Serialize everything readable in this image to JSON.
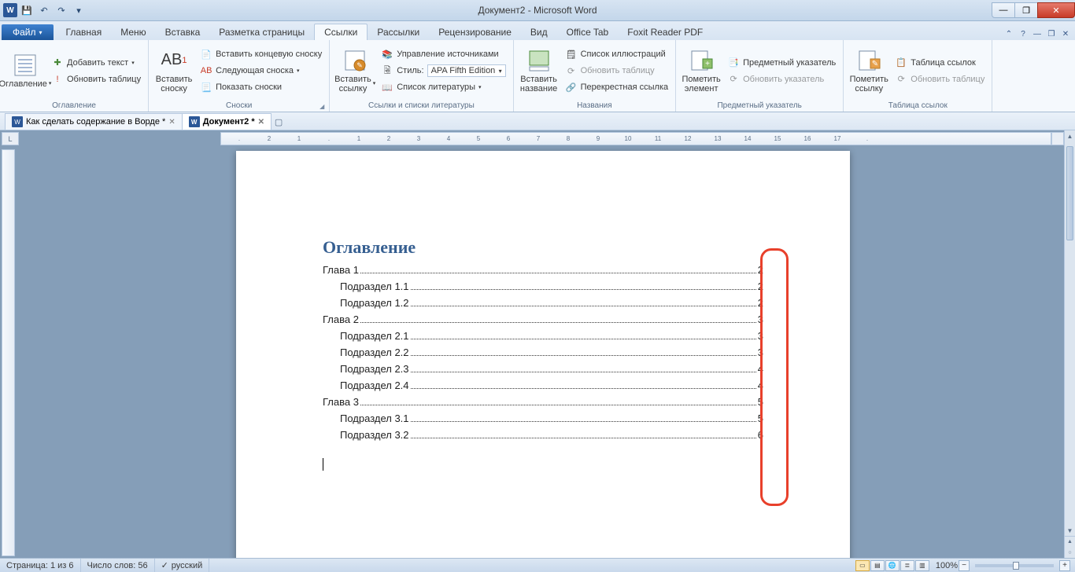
{
  "title": "Документ2 - Microsoft Word",
  "qat": {
    "save": "💾",
    "undo": "↶",
    "redo": "↷"
  },
  "tabs": {
    "file": "Файл",
    "items": [
      "Главная",
      "Меню",
      "Вставка",
      "Разметка страницы",
      "Ссылки",
      "Рассылки",
      "Рецензирование",
      "Вид",
      "Office Tab",
      "Foxit Reader PDF"
    ],
    "active": "Ссылки"
  },
  "ribbon": {
    "g1": {
      "label": "Оглавление",
      "toc": "Оглавление",
      "addText": "Добавить текст",
      "update": "Обновить таблицу"
    },
    "g2": {
      "label": "Сноски",
      "insert": "Вставить\nсноску",
      "endnote": "Вставить концевую сноску",
      "next": "Следующая сноска",
      "show": "Показать сноски",
      "ab": "AB",
      "abSup": "1"
    },
    "g3": {
      "label": "Ссылки и списки литературы",
      "insertCite": "Вставить\nссылку",
      "manage": "Управление источниками",
      "styleLbl": "Стиль:",
      "styleVal": "APA Fifth Edition",
      "biblio": "Список литературы"
    },
    "g4": {
      "label": "Названия",
      "caption": "Вставить\nназвание",
      "figures": "Список иллюстраций",
      "updateTbl": "Обновить таблицу",
      "crossref": "Перекрестная ссылка"
    },
    "g5": {
      "label": "Предметный указатель",
      "mark": "Пометить\nэлемент",
      "index": "Предметный указатель",
      "updateIdx": "Обновить указатель"
    },
    "g6": {
      "label": "Таблица ссылок",
      "markCite": "Пометить\nссылку",
      "toa": "Таблица ссылок",
      "updateToa": "Обновить таблицу"
    }
  },
  "docTabs": [
    {
      "name": "Как сделать содержание в Ворде *",
      "active": false
    },
    {
      "name": "Документ2 *",
      "active": true
    }
  ],
  "ruler": [
    ".",
    "2",
    "1",
    ".",
    "1",
    "2",
    "3",
    "4",
    "5",
    "6",
    "7",
    "8",
    "9",
    "10",
    "11",
    "12",
    "13",
    "14",
    "15",
    "16",
    "17",
    "."
  ],
  "rulerCorner": "L",
  "toc": {
    "title": "Оглавление",
    "entries": [
      {
        "level": 1,
        "text": "Глава 1",
        "page": "2"
      },
      {
        "level": 2,
        "text": "Подраздел 1.1",
        "page": "2"
      },
      {
        "level": 2,
        "text": "Подраздел 1.2",
        "page": "2"
      },
      {
        "level": 1,
        "text": "Глава 2",
        "page": "3"
      },
      {
        "level": 2,
        "text": "Подраздел 2.1",
        "page": "3"
      },
      {
        "level": 2,
        "text": "Подраздел 2.2",
        "page": "3"
      },
      {
        "level": 2,
        "text": "Подраздел 2.3",
        "page": "4"
      },
      {
        "level": 2,
        "text": "Подраздел 2.4",
        "page": "4"
      },
      {
        "level": 1,
        "text": "Глава 3",
        "page": "5"
      },
      {
        "level": 2,
        "text": "Подраздел 3.1",
        "page": "5"
      },
      {
        "level": 2,
        "text": "Подраздел 3.2",
        "page": "6"
      }
    ]
  },
  "status": {
    "page": "Страница: 1 из 6",
    "words": "Число слов: 56",
    "lang": "русский",
    "zoom": "100%"
  }
}
